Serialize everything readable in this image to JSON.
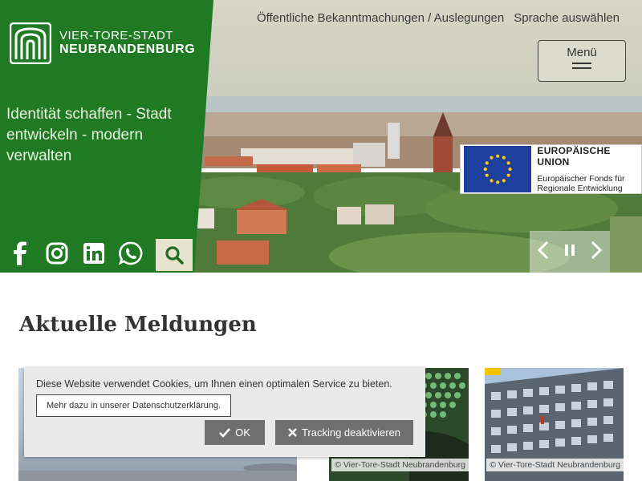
{
  "brand": {
    "line1": "VIER-TORE-STADT",
    "line2": "NEUBRANDENBURG",
    "green": "#1f7a23"
  },
  "hero": {
    "tagline": "Identität schaffen - Stadt entwickeln - modern verwalten"
  },
  "top_links": {
    "announcements": "Öffentliche Bekanntmachungen / Auslegungen",
    "language": "Sprache auswählen"
  },
  "menu": {
    "label": "Menü"
  },
  "social": [
    "facebook-icon",
    "instagram-icon",
    "linkedin-icon",
    "whatsapp-icon"
  ],
  "eu": {
    "title": "EUROPÄISCHE UNION",
    "sub1": "Europäischer Fonds für",
    "sub2": "Regionale Entwicklung"
  },
  "news": {
    "heading": "Aktuelle Meldungen",
    "cards": [
      {
        "caption": ""
      },
      {
        "caption": "© Vier-Tore-Stadt Neubrandenburg"
      },
      {
        "caption": "© Vier-Tore-Stadt Neubrandenburg"
      }
    ]
  },
  "cookie": {
    "text": "Diese Website verwendet Cookies, um Ihnen einen optimalen Service zu bieten.",
    "privacy_link": "Mehr dazu in unserer Datenschutzerklärung.",
    "ok_label": "OK",
    "tracking_label": "Tracking deaktivieren"
  },
  "colors": {
    "accent_green": "#1f7a23",
    "search_bg": "#e6e4cf",
    "button_gray": "#6f6f6f",
    "eu_blue": "#1f3f9e",
    "eu_star": "#ffcc00",
    "tag_yellow": "#f2c300"
  }
}
